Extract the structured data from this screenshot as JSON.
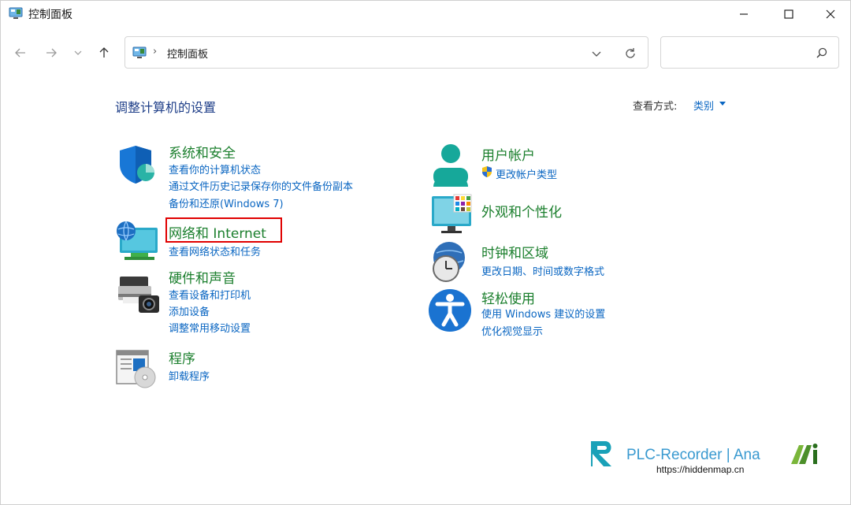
{
  "window": {
    "title": "控制面板"
  },
  "address_bar": {
    "separator": "›",
    "crumb": "控制面板"
  },
  "search": {
    "placeholder": "",
    "value": ""
  },
  "header": {
    "page_title": "调整计算机的设置",
    "view_by_label": "查看方式:",
    "view_by_value": "类别"
  },
  "categories": {
    "system_security": {
      "title": "系统和安全",
      "links": [
        "查看你的计算机状态",
        "通过文件历史记录保存你的文件备份副本",
        "备份和还原(Windows 7)"
      ]
    },
    "network": {
      "title": "网络和 Internet",
      "links": [
        "查看网络状态和任务"
      ]
    },
    "hardware": {
      "title": "硬件和声音",
      "links": [
        "查看设备和打印机",
        "添加设备",
        "调整常用移动设置"
      ]
    },
    "programs": {
      "title": "程序",
      "links": [
        "卸载程序"
      ]
    },
    "user_accounts": {
      "title": "用户帐户",
      "links": [
        "更改帐户类型"
      ]
    },
    "appearance": {
      "title": "外观和个性化",
      "links": []
    },
    "clock_region": {
      "title": "时钟和区域",
      "links": [
        "更改日期、时间或数字格式"
      ]
    },
    "ease_access": {
      "title": "轻松使用",
      "links": [
        "使用 Windows 建议的设置",
        "优化视觉显示"
      ]
    }
  },
  "watermark": {
    "brand": "PLC-Recorder | Ana",
    "url": "https://hiddenmap.cn"
  },
  "colors": {
    "category_title": "#1b7f2d",
    "link": "#0a66c2",
    "page_title": "#1e3e88",
    "highlight_box": "#e00000"
  }
}
